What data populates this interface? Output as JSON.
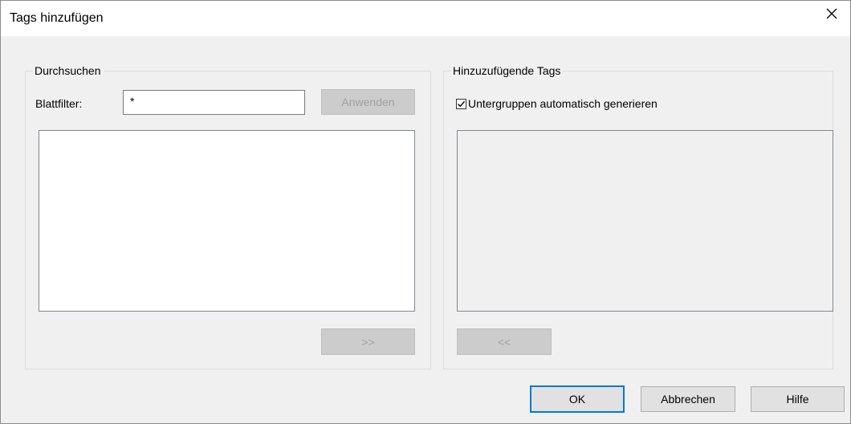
{
  "dialog": {
    "title": "Tags hinzufügen"
  },
  "browse": {
    "legend": "Durchsuchen",
    "filter_label": "Blattfilter:",
    "filter_value": "*",
    "apply_label": "Anwenden",
    "add_label": ">>"
  },
  "tags": {
    "legend": "Hinzuzufügende Tags",
    "auto_subgroups_label": "Untergruppen automatisch generieren",
    "auto_subgroups_checked": true,
    "remove_label": "<<"
  },
  "footer": {
    "ok_label": "OK",
    "cancel_label": "Abbrechen",
    "help_label": "Hilfe"
  },
  "colors": {
    "accent": "#0078d7",
    "window_bg": "#f0f0f0"
  },
  "icons": {
    "close": "close-icon",
    "checkbox": "checkmark-icon"
  }
}
